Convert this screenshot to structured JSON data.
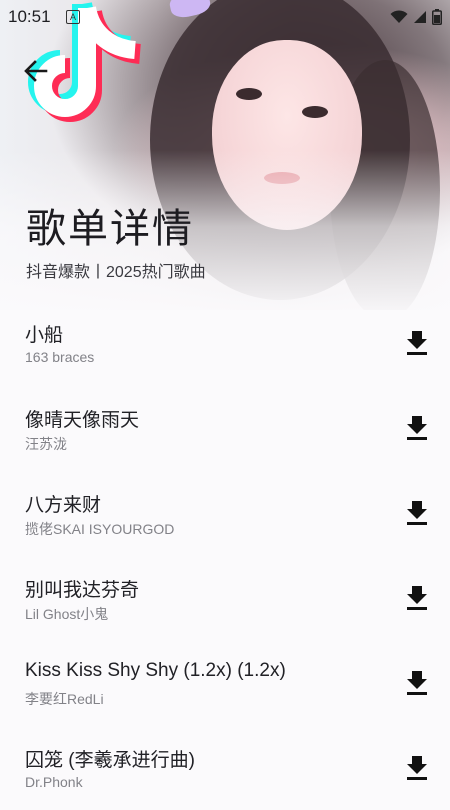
{
  "status": {
    "time": "10:51",
    "indicator": "A"
  },
  "header": {
    "title": "歌单详情",
    "subtitle": "抖音爆款丨2025热门歌曲"
  },
  "songs": [
    {
      "title": "小船",
      "artist": "163 braces"
    },
    {
      "title": "像晴天像雨天",
      "artist": "汪苏泷"
    },
    {
      "title": "八方来财",
      "artist": "揽佬SKAI ISYOURGOD"
    },
    {
      "title": "别叫我达芬奇",
      "artist": "Lil Ghost小鬼"
    },
    {
      "title": "Kiss Kiss Shy Shy (1.2x) (1.2x)",
      "artist": "李要红RedLi"
    },
    {
      "title": "囚笼 (李羲承进行曲)",
      "artist": "Dr.Phonk"
    }
  ],
  "icons": {
    "back": "arrow-left-icon",
    "download": "download-icon",
    "logo": "tiktok-logo",
    "wifi": "wifi-icon",
    "signal": "signal-icon",
    "battery": "battery-icon"
  },
  "colors": {
    "tiktok_cyan": "#25f4ee",
    "tiktok_red": "#fe2c55",
    "background": "#fbfafc"
  }
}
